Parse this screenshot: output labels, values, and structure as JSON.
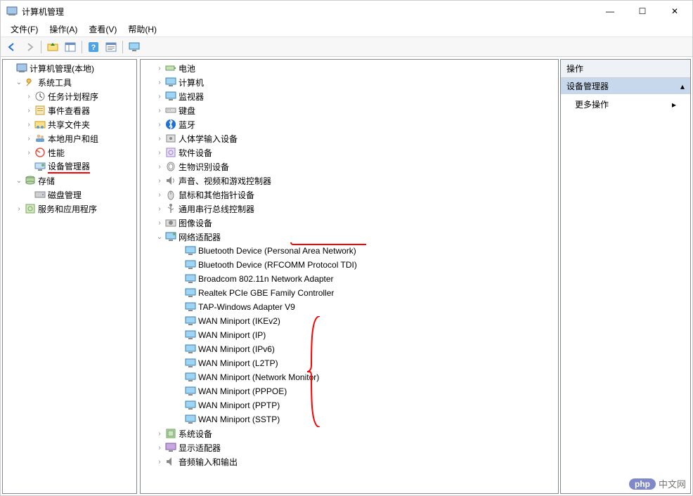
{
  "window": {
    "title": "计算机管理",
    "min": "—",
    "max": "☐",
    "close": "✕"
  },
  "menu": {
    "file": "文件(F)",
    "action": "操作(A)",
    "view": "查看(V)",
    "help": "帮助(H)"
  },
  "leftTree": {
    "root": "计算机管理(本地)",
    "systemTools": "系统工具",
    "taskScheduler": "任务计划程序",
    "eventViewer": "事件查看器",
    "sharedFolders": "共享文件夹",
    "localUsers": "本地用户和组",
    "performance": "性能",
    "deviceManager": "设备管理器",
    "storage": "存储",
    "diskMgmt": "磁盘管理",
    "services": "服务和应用程序"
  },
  "deviceTree": {
    "battery": "电池",
    "computer": "计算机",
    "monitors": "监视器",
    "keyboard": "键盘",
    "bluetooth": "蓝牙",
    "hid": "人体学输入设备",
    "software": "软件设备",
    "biometric": "生物识别设备",
    "sound": "声音、视频和游戏控制器",
    "mouse": "鼠标和其他指针设备",
    "usb": "通用串行总线控制器",
    "imaging": "图像设备",
    "netAdapters": "网络适配器",
    "net": {
      "btpan": "Bluetooth Device (Personal Area Network)",
      "btrfc": "Bluetooth Device (RFCOMM Protocol TDI)",
      "broadcom": "Broadcom 802.11n Network Adapter",
      "realtek": "Realtek PCIe GBE Family Controller",
      "tap": "TAP-Windows Adapter V9",
      "ikev2": "WAN Miniport (IKEv2)",
      "ip": "WAN Miniport (IP)",
      "ipv6": "WAN Miniport (IPv6)",
      "l2tp": "WAN Miniport (L2TP)",
      "netmon": "WAN Miniport (Network Monitor)",
      "pppoe": "WAN Miniport (PPPOE)",
      "pptp": "WAN Miniport (PPTP)",
      "sstp": "WAN Miniport (SSTP)"
    },
    "systemDevices": "系统设备",
    "displayAdapters": "显示适配器",
    "audioIO": "音频输入和输出"
  },
  "actions": {
    "header": "操作",
    "sub": "设备管理器",
    "more": "更多操作"
  },
  "watermark": {
    "badge": "php",
    "text": "中文网"
  }
}
